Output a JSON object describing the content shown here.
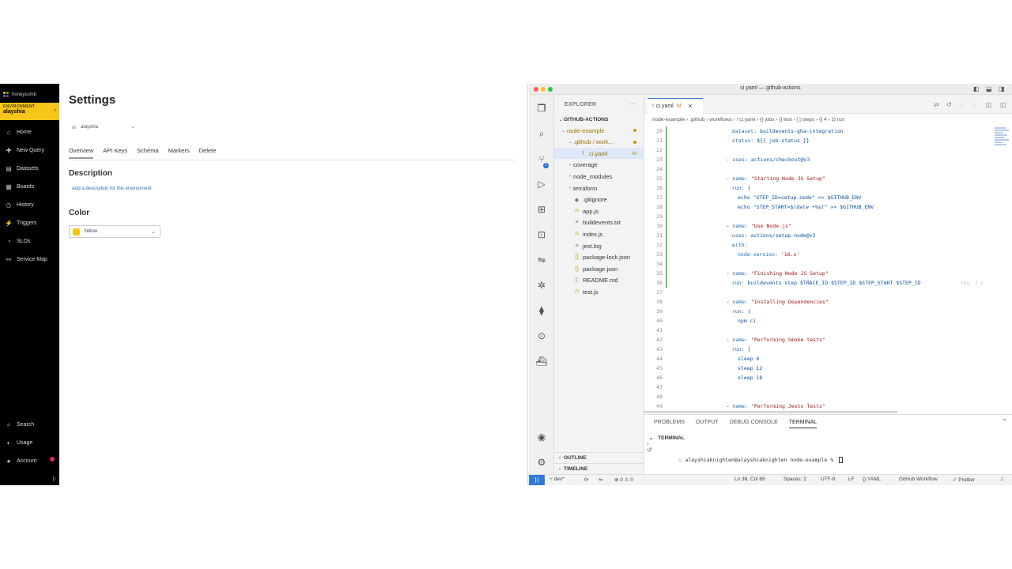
{
  "honeycomb": {
    "logo_text": "honeycomb",
    "env_label": "ENVIRONMENT",
    "env_value": "alayshia",
    "nav": [
      {
        "label": "Home",
        "icon": "home-icon"
      },
      {
        "label": "New Query",
        "icon": "query-icon"
      },
      {
        "label": "Datasets",
        "icon": "datasets-icon"
      },
      {
        "label": "Boards",
        "icon": "boards-icon"
      },
      {
        "label": "History",
        "icon": "history-icon"
      },
      {
        "label": "Triggers",
        "icon": "triggers-icon"
      },
      {
        "label": "SLOs",
        "icon": "slo-icon"
      },
      {
        "label": "Service Map",
        "icon": "service-map-icon"
      }
    ],
    "bottom_nav": [
      {
        "label": "Search",
        "icon": "search-icon"
      },
      {
        "label": "Usage",
        "icon": "usage-icon"
      },
      {
        "label": "Account",
        "icon": "account-icon"
      }
    ],
    "page_title": "Settings",
    "env_selector": "alayshia",
    "tabs": [
      "Overview",
      "API Keys",
      "Schema",
      "Markers",
      "Delete"
    ],
    "active_tab": "Overview",
    "description_heading": "Description",
    "description_link": "Add a description for this environment",
    "color_heading": "Color",
    "color_value": "Yellow",
    "color_swatch": "#f5c518"
  },
  "vscode": {
    "window_title": "ci.yaml — github-actions",
    "explorer_title": "EXPLORER",
    "workspace": "GITHUB-ACTIONS",
    "tree": [
      {
        "label": "node-example",
        "depth": 1,
        "twisty": "open",
        "icon": "",
        "mark": "dot"
      },
      {
        "label": ".github / work...",
        "depth": 2,
        "twisty": "open",
        "icon": "",
        "mark": "dot"
      },
      {
        "label": "ci.yaml",
        "depth": 3,
        "twisty": "",
        "icon": "!",
        "mark": "M",
        "selected": true
      },
      {
        "label": "coverage",
        "depth": 2,
        "twisty": "closed",
        "icon": "",
        "mark": ""
      },
      {
        "label": "node_modules",
        "depth": 2,
        "twisty": "closed",
        "icon": "",
        "mark": ""
      },
      {
        "label": "terraform",
        "depth": 2,
        "twisty": "closed",
        "icon": "",
        "mark": ""
      },
      {
        "label": ".gitignore",
        "depth": 2,
        "twisty": "",
        "icon": "◆",
        "mark": ""
      },
      {
        "label": "app.js",
        "depth": 2,
        "twisty": "",
        "icon": "JS",
        "mark": ""
      },
      {
        "label": "buildevents.txt",
        "depth": 2,
        "twisty": "",
        "icon": "≡",
        "mark": ""
      },
      {
        "label": "index.js",
        "depth": 2,
        "twisty": "",
        "icon": "JS",
        "mark": ""
      },
      {
        "label": "jest.log",
        "depth": 2,
        "twisty": "",
        "icon": "≡",
        "mark": ""
      },
      {
        "label": "package-lock.json",
        "depth": 2,
        "twisty": "",
        "icon": "{}",
        "mark": ""
      },
      {
        "label": "package.json",
        "depth": 2,
        "twisty": "",
        "icon": "{}",
        "mark": ""
      },
      {
        "label": "README.md",
        "depth": 2,
        "twisty": "",
        "icon": "ⓘ",
        "mark": ""
      },
      {
        "label": "test.js",
        "depth": 2,
        "twisty": "",
        "icon": "JS",
        "mark": ""
      }
    ],
    "outline_label": "OUTLINE",
    "timeline_label": "TIMELINE",
    "tab_label": "ci.yaml",
    "tab_mark": "M",
    "breadcrumbs": "node-example  ›  .github  ›  workflows  ›  ! ci.yaml  ›  {} jobs  ›  {} test  ›  [ ] steps  ›  {} 4  ›  ⊡ run",
    "code_lines": [
      {
        "n": "20",
        "indent": 8,
        "parts": [
          [
            "k",
            "dataset: "
          ],
          [
            "v",
            "buildevents-gha-integration"
          ]
        ]
      },
      {
        "n": "21",
        "indent": 8,
        "parts": [
          [
            "k",
            "status: "
          ],
          [
            "v",
            "${{ job.status }}"
          ]
        ]
      },
      {
        "n": "22",
        "indent": 0,
        "parts": []
      },
      {
        "n": "23",
        "indent": 6,
        "parts": [
          [
            "p",
            "- "
          ],
          [
            "k",
            "uses: "
          ],
          [
            "v",
            "actions/checkout@v3"
          ]
        ]
      },
      {
        "n": "24",
        "indent": 0,
        "parts": []
      },
      {
        "n": "25",
        "indent": 6,
        "parts": [
          [
            "p",
            "- "
          ],
          [
            "k",
            "name: "
          ],
          [
            "s",
            "\"Starting Node JS Setup\""
          ]
        ]
      },
      {
        "n": "26",
        "indent": 8,
        "parts": [
          [
            "k",
            "run: "
          ],
          [
            "p",
            "|"
          ]
        ]
      },
      {
        "n": "27",
        "indent": 10,
        "parts": [
          [
            "v",
            "echo \"STEP_ID=setup-node\" >> $GITHUB_ENV"
          ]
        ]
      },
      {
        "n": "28",
        "indent": 10,
        "parts": [
          [
            "v",
            "echo \"STEP_START=$(date +%s)\" >> $GITHUB_ENV"
          ]
        ]
      },
      {
        "n": "29",
        "indent": 0,
        "parts": []
      },
      {
        "n": "30",
        "indent": 6,
        "parts": [
          [
            "p",
            "- "
          ],
          [
            "k",
            "name: "
          ],
          [
            "s",
            "\"Use Node.js\""
          ]
        ]
      },
      {
        "n": "31",
        "indent": 8,
        "parts": [
          [
            "k",
            "uses: "
          ],
          [
            "v",
            "actions/setup-node@v3"
          ]
        ]
      },
      {
        "n": "32",
        "indent": 8,
        "parts": [
          [
            "k",
            "with:"
          ]
        ]
      },
      {
        "n": "33",
        "indent": 10,
        "parts": [
          [
            "k",
            "node-version: "
          ],
          [
            "s",
            "'16.x'"
          ]
        ]
      },
      {
        "n": "34",
        "indent": 0,
        "parts": []
      },
      {
        "n": "35",
        "indent": 6,
        "parts": [
          [
            "p",
            "- "
          ],
          [
            "k",
            "name: "
          ],
          [
            "s",
            "\"Finishing Node JS Setup\""
          ]
        ]
      },
      {
        "n": "36",
        "indent": 8,
        "parts": [
          [
            "k",
            "run: "
          ],
          [
            "v",
            "buildevents step $TRACE_ID $STEP_ID $STEP_START $STEP_ID"
          ]
        ],
        "blame": "You, 1 s"
      },
      {
        "n": "37",
        "indent": 0,
        "parts": []
      },
      {
        "n": "38",
        "indent": 6,
        "parts": [
          [
            "p",
            "- "
          ],
          [
            "k",
            "name: "
          ],
          [
            "s",
            "\"Installing Dependencies\""
          ]
        ]
      },
      {
        "n": "39",
        "indent": 8,
        "parts": [
          [
            "k",
            "run: "
          ],
          [
            "p",
            "|"
          ]
        ]
      },
      {
        "n": "40",
        "indent": 10,
        "parts": [
          [
            "v",
            "npm ci"
          ]
        ]
      },
      {
        "n": "41",
        "indent": 0,
        "parts": []
      },
      {
        "n": "42",
        "indent": 6,
        "parts": [
          [
            "p",
            "- "
          ],
          [
            "k",
            "name: "
          ],
          [
            "s",
            "\"Performing Smoke tests\""
          ]
        ]
      },
      {
        "n": "43",
        "indent": 8,
        "parts": [
          [
            "k",
            "run: "
          ],
          [
            "p",
            "|"
          ]
        ]
      },
      {
        "n": "44",
        "indent": 10,
        "parts": [
          [
            "v",
            "sleep 6"
          ]
        ]
      },
      {
        "n": "45",
        "indent": 10,
        "parts": [
          [
            "v",
            "sleep 12"
          ]
        ]
      },
      {
        "n": "46",
        "indent": 10,
        "parts": [
          [
            "v",
            "sleep 18"
          ]
        ]
      },
      {
        "n": "47",
        "indent": 0,
        "parts": []
      },
      {
        "n": "48",
        "indent": 0,
        "parts": []
      },
      {
        "n": "49",
        "indent": 6,
        "parts": [
          [
            "p",
            "- "
          ],
          [
            "k",
            "name: "
          ],
          [
            "s",
            "\"Performing Jests Tests\""
          ]
        ]
      }
    ],
    "panel_tabs": [
      "PROBLEMS",
      "OUTPUT",
      "DEBUG CONSOLE",
      "TERMINAL"
    ],
    "active_panel_tab": "TERMINAL",
    "terminal_heading": "TERMINAL",
    "terminal_prompt": "alayshiaknighten@alayshiaknighten node-example % ",
    "status": {
      "branch": "dev*",
      "problems": "⊗ 0 ⚠ 0",
      "position": "Ln 36, Col 69",
      "spaces": "Spaces: 2",
      "encoding": "UTF-8",
      "eol": "LF",
      "language": "{} YAML",
      "workflow": "GitHub Workflow",
      "formatter": "✓ Prettier"
    }
  }
}
